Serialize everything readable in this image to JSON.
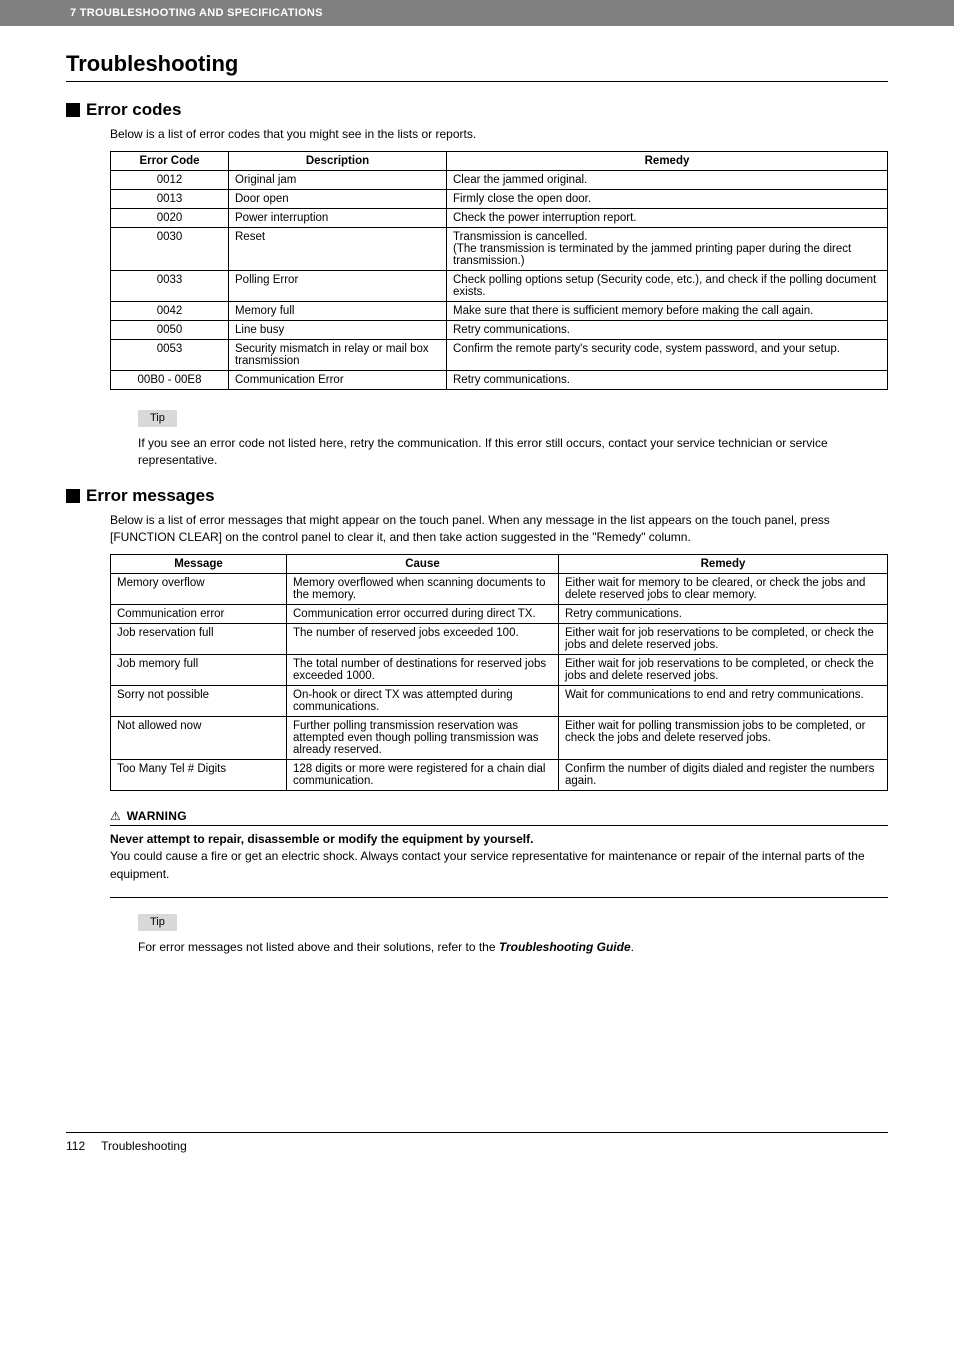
{
  "header": {
    "chapter": "7 TROUBLESHOOTING AND SPECIFICATIONS"
  },
  "title": "Troubleshooting",
  "section1": {
    "heading": "Error codes",
    "intro": "Below is a list of error codes that you might see in the lists or reports.",
    "cols": {
      "h1": "Error Code",
      "h2": "Description",
      "h3": "Remedy"
    },
    "rows": [
      {
        "code": "0012",
        "desc": "Original jam",
        "rem": "Clear the jammed original."
      },
      {
        "code": "0013",
        "desc": "Door open",
        "rem": "Firmly close the open door."
      },
      {
        "code": "0020",
        "desc": "Power interruption",
        "rem": "Check the power interruption report."
      },
      {
        "code": "0030",
        "desc": "Reset",
        "rem": "Transmission is cancelled.\n(The transmission is terminated by the jammed printing paper during the direct transmission.)"
      },
      {
        "code": "0033",
        "desc": "Polling Error",
        "rem": "Check polling options setup (Security code, etc.), and check if the polling document exists."
      },
      {
        "code": "0042",
        "desc": "Memory full",
        "rem": "Make sure that there is sufficient memory before making the call again."
      },
      {
        "code": "0050",
        "desc": "Line busy",
        "rem": "Retry communications."
      },
      {
        "code": "0053",
        "desc": "Security mismatch in relay or mail box transmission",
        "rem": "Confirm the remote party's security code, system password, and your setup."
      },
      {
        "code": "00B0 - 00E8",
        "desc": "Communication Error",
        "rem": "Retry communications."
      }
    ]
  },
  "tip1": {
    "label": "Tip",
    "text": "If you see an error code not listed here, retry the communication. If this error still occurs, contact your service technician or service representative."
  },
  "section2": {
    "heading": "Error messages",
    "intro": "Below is a list of error messages that might appear on the touch panel. When any message in the list appears on the touch panel, press [FUNCTION CLEAR] on the control panel to clear it, and then take action suggested in the \"Remedy\" column.",
    "cols": {
      "h1": "Message",
      "h2": "Cause",
      "h3": "Remedy"
    },
    "rows": [
      {
        "msg": "Memory overflow",
        "cause": "Memory overflowed when scanning documents to the memory.",
        "rem": "Either wait for memory to be cleared, or check the jobs and delete reserved jobs to clear memory."
      },
      {
        "msg": "Communication error",
        "cause": "Communication error occurred during direct TX.",
        "rem": "Retry communications."
      },
      {
        "msg": "Job reservation full",
        "cause": "The number of reserved jobs exceeded 100.",
        "rem": "Either wait for job reservations to be completed, or check the jobs and delete reserved jobs."
      },
      {
        "msg": "Job memory full",
        "cause": "The total number of destinations for reserved jobs exceeded 1000.",
        "rem": "Either wait for job reservations to be completed, or check the jobs and delete reserved jobs."
      },
      {
        "msg": "Sorry not possible",
        "cause": "On-hook or direct TX was attempted during communications.",
        "rem": "Wait for communications to end and retry communications."
      },
      {
        "msg": "Not allowed now",
        "cause": "Further polling transmission reservation was attempted even though polling transmission was already reserved.",
        "rem": "Either wait for polling transmission jobs to be completed, or check the jobs and delete reserved jobs."
      },
      {
        "msg": "Too Many Tel # Digits",
        "cause": "128 digits or more were registered for a chain dial communication.",
        "rem": "Confirm the number of digits dialed and register the numbers again."
      }
    ]
  },
  "warning": {
    "icon": "⚠",
    "label": "WARNING",
    "title": "Never attempt to repair, disassemble or modify the equipment by yourself.",
    "text": "You could cause a fire or get an electric shock. Always contact your service representative for maintenance or repair of the internal parts of the equipment."
  },
  "tip2": {
    "label": "Tip",
    "text_lead": "For error messages not listed above and their solutions, refer to the ",
    "text_ref": "Troubleshooting Guide",
    "text_tail": "."
  },
  "footer": {
    "page": "112",
    "title": "Troubleshooting"
  }
}
